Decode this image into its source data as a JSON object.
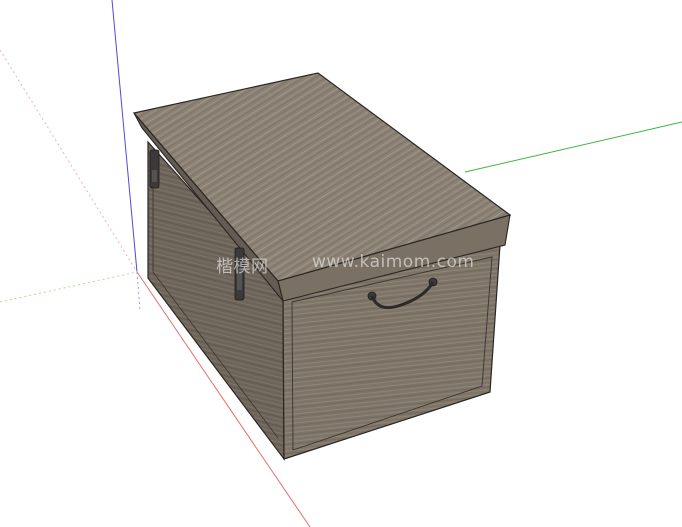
{
  "viewport": {
    "background": "#ffffff",
    "model": "wooden-storage-chest",
    "axes": {
      "red": "#e07070",
      "green": "#3cb83c",
      "blue": "#4a4ae0"
    }
  },
  "model": {
    "wood_top": "#8a8174",
    "wood_front": "#7d7466",
    "wood_side": "#6a6156",
    "edge": "#2a2622",
    "hardware": "#3b3a38"
  },
  "watermark": {
    "site_name": "楷模网",
    "url": "www.kaimom.com"
  }
}
